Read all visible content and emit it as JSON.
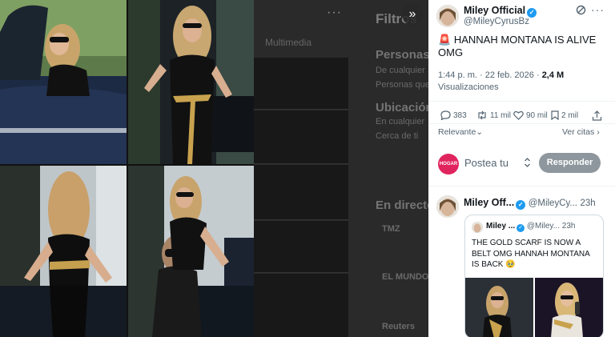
{
  "background": {
    "filters_heading": "Filtros",
    "tabs_partial": "Multimedia",
    "sections": [
      {
        "heading": "Personas",
        "lines": [
          "De cualquier",
          "Personas que"
        ]
      },
      {
        "heading": "Ubicación",
        "lines": [
          "En cualquier",
          "Cerca de ti"
        ]
      },
      {
        "heading": "En directo",
        "lines": []
      }
    ],
    "news_sources": [
      "TMZ",
      "EL MUNDO",
      "Reuters"
    ]
  },
  "viewer": {
    "expand_icon": "chevron-double-right-icon",
    "image_count": 4
  },
  "tweet": {
    "author_name": "Miley Official",
    "author_handle": "@MileyCyrusBz",
    "emoji": "🚨",
    "text": "HANNAH MONTANA IS ALIVE OMG",
    "time": "1:44 p. m.",
    "sep": "·",
    "date": "22 feb. 2026",
    "views_count": "2,4 M",
    "views_label": "Visualizaciones",
    "replies": "383",
    "retweets": "11 mil",
    "likes": "90 mil",
    "bookmarks": "2 mil",
    "sort_label": "Relevante",
    "view_quotes": "Ver citas",
    "reply_avatar_text": "HOGAR",
    "reply_placeholder": "Postea tu",
    "reply_button": "Responder"
  },
  "reply_tweet": {
    "author_name": "Miley Off...",
    "author_handle": "@MileyCy...",
    "time": "23h",
    "quote": {
      "author_name": "Miley ...",
      "author_handle": "@Miley...",
      "time": "23h",
      "text": "THE GOLD SCARF IS NOW A BELT OMG HANNAH MONTANA IS BACK 🥹"
    }
  },
  "colors": {
    "accent": "#1d9bf0",
    "button_disabled": "#8e979d",
    "text_secondary": "#536471"
  }
}
